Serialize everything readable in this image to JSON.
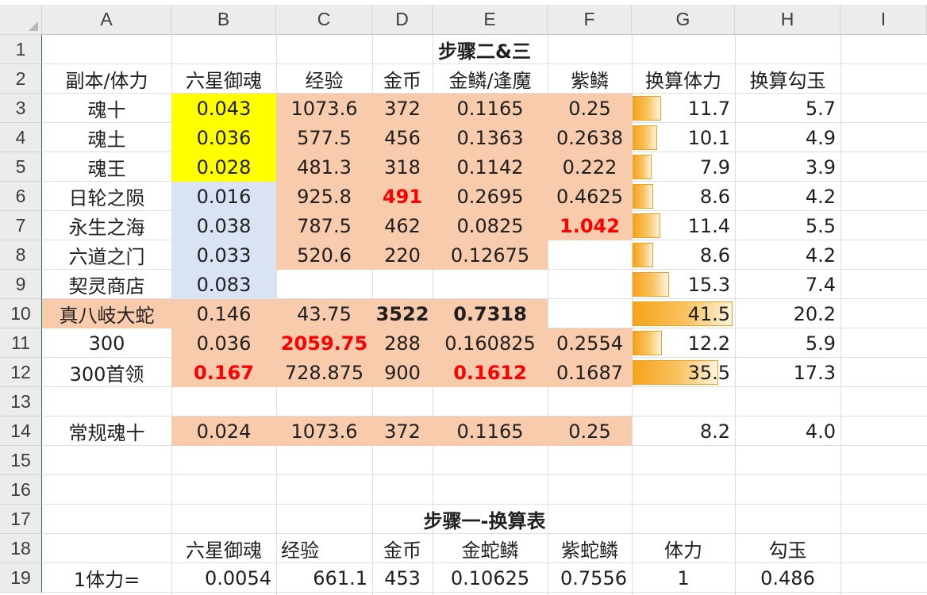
{
  "columns": [
    "A",
    "B",
    "C",
    "D",
    "E",
    "F",
    "G",
    "H",
    "I"
  ],
  "rows": [
    "1",
    "2",
    "3",
    "4",
    "5",
    "6",
    "7",
    "8",
    "9",
    "10",
    "11",
    "12",
    "13",
    "14",
    "15",
    "16",
    "17",
    "18",
    "19"
  ],
  "title_step23": "步骤二&三",
  "headers": [
    "副本/体力",
    "六星御魂",
    "经验",
    "金币",
    "金鳞/逢魔",
    "紫鳞",
    "换算体力",
    "换算勾玉"
  ],
  "table": [
    {
      "name": "魂十",
      "yuhun": "0.043",
      "exp": "1073.6",
      "coin": "372",
      "jinlin": "0.1165",
      "zilin": "0.25",
      "tili": "11.7",
      "gouyu": "5.7"
    },
    {
      "name": "魂土",
      "yuhun": "0.036",
      "exp": "577.5",
      "coin": "456",
      "jinlin": "0.1363",
      "zilin": "0.2638",
      "tili": "10.1",
      "gouyu": "4.9"
    },
    {
      "name": "魂王",
      "yuhun": "0.028",
      "exp": "481.3",
      "coin": "318",
      "jinlin": "0.1142",
      "zilin": "0.222",
      "tili": "7.9",
      "gouyu": "3.9"
    },
    {
      "name": "日轮之陨",
      "yuhun": "0.016",
      "exp": "925.8",
      "coin": "491",
      "jinlin": "0.2695",
      "zilin": "0.4625",
      "tili": "8.6",
      "gouyu": "4.2"
    },
    {
      "name": "永生之海",
      "yuhun": "0.038",
      "exp": "787.5",
      "coin": "462",
      "jinlin": "0.0825",
      "zilin": "1.042",
      "tili": "11.4",
      "gouyu": "5.5"
    },
    {
      "name": "六道之门",
      "yuhun": "0.033",
      "exp": "520.6",
      "coin": "220",
      "jinlin": "0.12675",
      "zilin": "",
      "tili": "8.6",
      "gouyu": "4.2"
    },
    {
      "name": "契灵商店",
      "yuhun": "0.083",
      "exp": "",
      "coin": "",
      "jinlin": "",
      "zilin": "",
      "tili": "15.3",
      "gouyu": "7.4"
    },
    {
      "name": "真八岐大蛇",
      "yuhun": "0.146",
      "exp": "43.75",
      "coin": "3522",
      "jinlin": "0.7318",
      "zilin": "",
      "tili": "41.5",
      "gouyu": "20.2"
    },
    {
      "name": "300",
      "yuhun": "0.036",
      "exp": "2059.75",
      "coin": "288",
      "jinlin": "0.160825",
      "zilin": "0.2554",
      "tili": "12.2",
      "gouyu": "5.9"
    },
    {
      "name": "300首领",
      "yuhun": "0.167",
      "exp": "728.875",
      "coin": "900",
      "jinlin": "0.1612",
      "zilin": "0.1687",
      "tili": "35.5",
      "gouyu": "17.3"
    }
  ],
  "row14": {
    "name": "常规魂十",
    "yuhun": "0.024",
    "exp": "1073.6",
    "coin": "372",
    "jinlin": "0.1165",
    "zilin": "0.25",
    "tili": "8.2",
    "gouyu": "4.0"
  },
  "title_step1": "步骤一-换算表",
  "headers2": [
    "六星御魂",
    "经验",
    "金币",
    "金蛇鳞",
    "紫蛇鳞",
    "体力",
    "勾玉"
  ],
  "row19": {
    "label": "1体力=",
    "yuhun": "0.0054",
    "exp": "661.1",
    "coin": "453",
    "jinshelin": "0.10625",
    "zishelin": "0.7556",
    "tili": "1",
    "gouyu": "0.486"
  },
  "databar_max": 41.5,
  "colors": {
    "yellow": "#ffff00",
    "blue": "#dae3f3",
    "peach": "#f8cbad",
    "red_text": "#ff0000",
    "databar": "#f5a31a"
  }
}
